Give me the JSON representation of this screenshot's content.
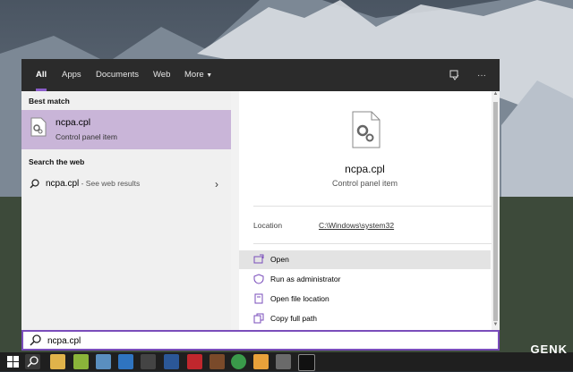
{
  "tabs": [
    {
      "label": "All",
      "active": true
    },
    {
      "label": "Apps"
    },
    {
      "label": "Documents"
    },
    {
      "label": "Web"
    },
    {
      "label": "More"
    }
  ],
  "topbar_icons": [
    "feedback-icon",
    "ellipsis-icon"
  ],
  "left": {
    "best_match_header": "Best match",
    "best_match": {
      "title": "ncpa.cpl",
      "subtitle": "Control panel item",
      "icon": "control-panel-file-icon"
    },
    "web_header": "Search the web",
    "web_result": {
      "query": "ncpa.cpl",
      "suffix": " - See web results"
    }
  },
  "right": {
    "title": "ncpa.cpl",
    "subtitle": "Control panel item",
    "location_label": "Location",
    "location_value": "C:\\Windows\\system32",
    "actions": [
      {
        "label": "Open",
        "icon": "open-icon",
        "highlighted": true
      },
      {
        "label": "Run as administrator",
        "icon": "shield-admin-icon"
      },
      {
        "label": "Open file location",
        "icon": "folder-location-icon"
      },
      {
        "label": "Copy full path",
        "icon": "copy-icon"
      }
    ]
  },
  "search": {
    "value": "ncpa.cpl"
  },
  "taskbar": {
    "icons": [
      "windows-start-icon",
      "search-icon",
      "file-explorer-icon",
      "vectr-icon",
      "paint-icon",
      "three-d-icon",
      "mail-icon",
      "word-icon",
      "vivaldi-icon",
      "media-icon",
      "chrome-icon",
      "player-icon",
      "app-icon",
      "terminal-icon"
    ]
  },
  "watermark": "GENK",
  "colors": {
    "accent": "#7a4dbb",
    "selection": "#c9b5d8",
    "topbar": "#2b2b2b"
  }
}
